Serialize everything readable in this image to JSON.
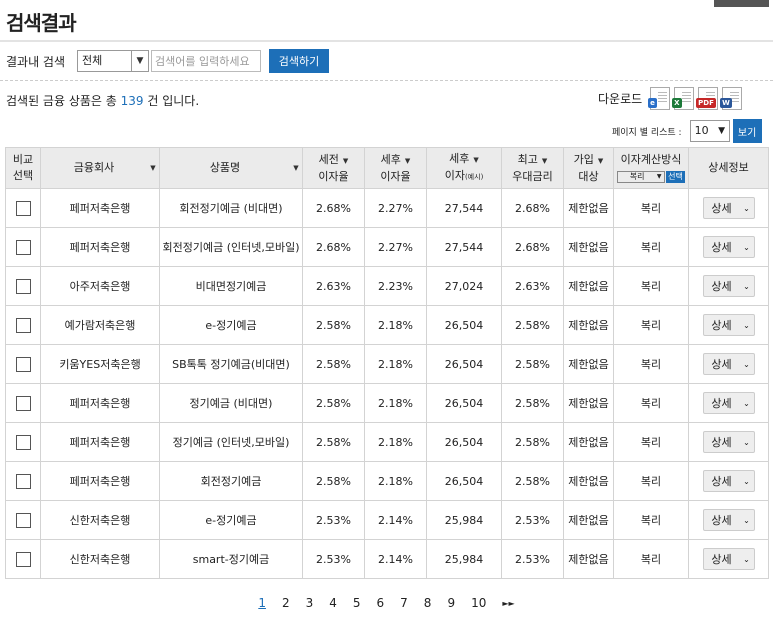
{
  "page": {
    "title": "검색결과"
  },
  "search": {
    "label": "결과내 검색",
    "scope_value": "전체",
    "placeholder": "검색어를 입력하세요",
    "button_label": "검색하기"
  },
  "summary": {
    "prefix": "검색된 금융 상품은 총 ",
    "count": "139",
    "suffix": " 건 입니다."
  },
  "download": {
    "label": "다운로드",
    "icons": [
      "ie-html-icon",
      "excel-icon",
      "pdf-icon",
      "word-icon"
    ],
    "badges": [
      "e",
      "X",
      "PDF",
      "W"
    ],
    "badge_colors": [
      "#2a6fc9",
      "#1d7a3a",
      "#c62828",
      "#2b579a"
    ]
  },
  "per_page": {
    "label": "페이지 별 리스트 :",
    "value": "10",
    "button_label": "보기"
  },
  "table": {
    "headers": {
      "compare": [
        "비교",
        "선택"
      ],
      "company": "금융회사",
      "product": "상품명",
      "pre_tax": [
        "세전",
        "이자율"
      ],
      "post_tax": [
        "세후",
        "이자율"
      ],
      "post_tax_interest": [
        "세후",
        "이자",
        "(예시)"
      ],
      "max_rate": [
        "최고",
        "우대금리"
      ],
      "eligibility": [
        "가입",
        "대상"
      ],
      "calc_method": "이자계산방식",
      "calc_select": "복리",
      "calc_button": "선택",
      "detail": "상세정보"
    },
    "rows": [
      {
        "company": "페퍼저축은행",
        "product": "회전정기예금 (비대면)",
        "pre_tax": "2.68%",
        "post_tax": "2.27%",
        "interest": "27,544",
        "max_rate": "2.68%",
        "eligibility": "제한없음",
        "method": "복리",
        "detail": "상세"
      },
      {
        "company": "페퍼저축은행",
        "product": "회전정기예금 (인터넷,모바일)",
        "pre_tax": "2.68%",
        "post_tax": "2.27%",
        "interest": "27,544",
        "max_rate": "2.68%",
        "eligibility": "제한없음",
        "method": "복리",
        "detail": "상세"
      },
      {
        "company": "아주저축은행",
        "product": "비대면정기예금",
        "pre_tax": "2.63%",
        "post_tax": "2.23%",
        "interest": "27,024",
        "max_rate": "2.63%",
        "eligibility": "제한없음",
        "method": "복리",
        "detail": "상세"
      },
      {
        "company": "예가람저축은행",
        "product": "e-정기예금",
        "pre_tax": "2.58%",
        "post_tax": "2.18%",
        "interest": "26,504",
        "max_rate": "2.58%",
        "eligibility": "제한없음",
        "method": "복리",
        "detail": "상세"
      },
      {
        "company": "키움YES저축은행",
        "product": "SB톡톡 정기예금(비대면)",
        "pre_tax": "2.58%",
        "post_tax": "2.18%",
        "interest": "26,504",
        "max_rate": "2.58%",
        "eligibility": "제한없음",
        "method": "복리",
        "detail": "상세"
      },
      {
        "company": "페퍼저축은행",
        "product": "정기예금 (비대면)",
        "pre_tax": "2.58%",
        "post_tax": "2.18%",
        "interest": "26,504",
        "max_rate": "2.58%",
        "eligibility": "제한없음",
        "method": "복리",
        "detail": "상세"
      },
      {
        "company": "페퍼저축은행",
        "product": "정기예금 (인터넷,모바일)",
        "pre_tax": "2.58%",
        "post_tax": "2.18%",
        "interest": "26,504",
        "max_rate": "2.58%",
        "eligibility": "제한없음",
        "method": "복리",
        "detail": "상세"
      },
      {
        "company": "페퍼저축은행",
        "product": "회전정기예금",
        "pre_tax": "2.58%",
        "post_tax": "2.18%",
        "interest": "26,504",
        "max_rate": "2.58%",
        "eligibility": "제한없음",
        "method": "복리",
        "detail": "상세"
      },
      {
        "company": "신한저축은행",
        "product": "e-정기예금",
        "pre_tax": "2.53%",
        "post_tax": "2.14%",
        "interest": "25,984",
        "max_rate": "2.53%",
        "eligibility": "제한없음",
        "method": "복리",
        "detail": "상세"
      },
      {
        "company": "신한저축은행",
        "product": "smart-정기예금",
        "pre_tax": "2.53%",
        "post_tax": "2.14%",
        "interest": "25,984",
        "max_rate": "2.53%",
        "eligibility": "제한없음",
        "method": "복리",
        "detail": "상세"
      }
    ]
  },
  "pagination": {
    "pages": [
      "1",
      "2",
      "3",
      "4",
      "5",
      "6",
      "7",
      "8",
      "9",
      "10"
    ],
    "current": "1",
    "next_label": "►►"
  }
}
